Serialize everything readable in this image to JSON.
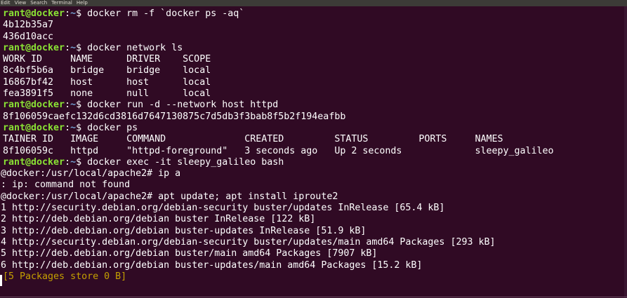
{
  "menu": {
    "items": [
      "Edit",
      "View",
      "Search",
      "Terminal",
      "Help"
    ]
  },
  "colors": {
    "background": "#300a24",
    "prompt_user": "#8ae234",
    "prompt_path": "#729fcf",
    "progress": "#c4a000",
    "text": "#ffffff"
  },
  "terminal": {
    "prompt_user": "rant@docker",
    "prompt_sep": ":",
    "prompt_path": "~",
    "prompt_end": "$ ",
    "cmd1": "docker rm -f `docker ps -aq`",
    "out1": [
      "4b12b35a7",
      "436d10acc"
    ],
    "cmd2": "docker network ls",
    "net_header": "WORK ID     NAME      DRIVER    SCOPE",
    "net_rows": [
      "8c4bf5b6a   bridge    bridge    local",
      "16867bf42   host      host      local",
      "fea3891f5   none      null      local"
    ],
    "cmd3": "docker run -d --network host httpd",
    "container_id": "8f106059caefc132d6cd3816d7647130875c7d5db3f3bab8f5b2f194eafbb",
    "cmd4": "docker ps",
    "ps_header": "TAINER ID   IMAGE     COMMAND              CREATED         STATUS         PORTS     NAMES",
    "ps_row": "8f106059c   httpd     \"httpd-foreground\"   3 seconds ago   Up 2 seconds             sleepy_galileo",
    "cmd5": "docker exec -it sleepy_galileo bash",
    "bash_prompt1": "t@docker:/usr/local/apache2# ip a",
    "error": "h: ip: command not found",
    "bash_prompt2": "t@docker:/usr/local/apache2# apt update; apt install iproute2",
    "apt_lines": [
      ":1 http://security.debian.org/debian-security buster/updates InRelease [65.4 kB]",
      ":2 http://deb.debian.org/debian buster InRelease [122 kB]",
      ":3 http://deb.debian.org/debian buster-updates InRelease [51.9 kB]",
      ":4 http://security.debian.org/debian-security buster/updates/main amd64 Packages [293 kB]",
      ":5 http://deb.debian.org/debian buster/main amd64 Packages [7907 kB]",
      ":6 http://deb.debian.org/debian buster-updates/main amd64 Packages [15.2 kB]"
    ],
    "progress": "[5 Packages store 0 B]"
  }
}
